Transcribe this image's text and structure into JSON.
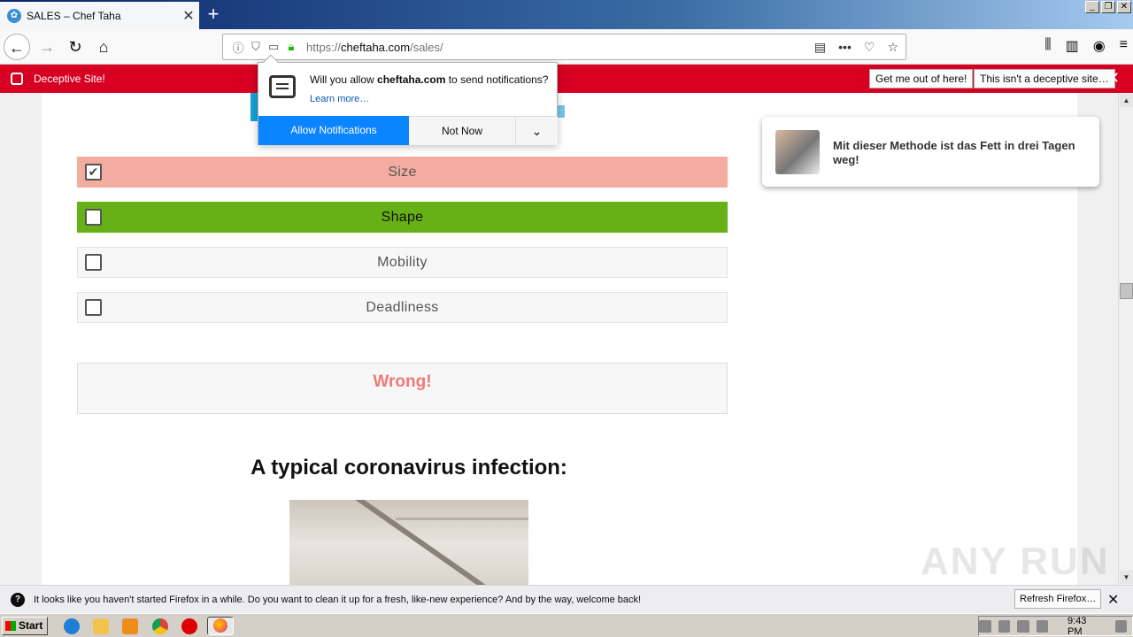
{
  "window": {
    "tab_title": "SALES – Chef Taha",
    "tab_close": "✕",
    "new_tab": "+",
    "controls": [
      "_",
      "❐",
      "✕"
    ]
  },
  "nav": {
    "url_scheme": "https://",
    "url_host": "cheftaha.com",
    "url_path": "/sales/",
    "icons": [
      "back-arrow-icon",
      "forward-arrow-icon",
      "reload-icon",
      "home-icon",
      "info-icon",
      "tracking-shield-icon",
      "notification-icon",
      "lock-icon",
      "reader-view-icon",
      "more-actions-icon",
      "pocket-icon",
      "bookmark-star-icon",
      "library-icon",
      "sidebar-icon",
      "account-icon",
      "hamburger-menu-icon"
    ]
  },
  "deceptive_bar": {
    "message": "Deceptive Site!",
    "get_out_button": "Get me out of here!",
    "not_deceptive_button": "This isn't a deceptive site…",
    "close": "✕"
  },
  "notification_popup": {
    "message_prefix": "Will you allow ",
    "message_host": "cheftaha.com",
    "message_suffix": " to send notifications?",
    "learn_more": "Learn more…",
    "allow_button": "Allow Notifications",
    "not_now_button": "Not Now",
    "more_chevron": "⌄"
  },
  "quiz": {
    "options": [
      {
        "label": "Size",
        "checked": true,
        "check_glyph": "✔"
      },
      {
        "label": "Shape",
        "checked": false,
        "check_glyph": ""
      },
      {
        "label": "Mobility",
        "checked": false,
        "check_glyph": ""
      },
      {
        "label": "Deadliness",
        "checked": false,
        "check_glyph": ""
      }
    ],
    "result": "Wrong!"
  },
  "article": {
    "heading": "A typical coronavirus infection:"
  },
  "ad": {
    "text": "Mit dieser Methode ist das Fett in drei Tagen weg!"
  },
  "watermark": "ANY RUN",
  "firefox_bar": {
    "info_glyph": "?",
    "message": "It looks like you haven't started Firefox in a while. Do you want to clean it up for a fresh, like-new experience? And by the way, welcome back!",
    "refresh_button": "Refresh Firefox…",
    "close": "✕"
  },
  "taskbar": {
    "start": "Start",
    "clock": "9:43 PM"
  },
  "colors": {
    "deceptive_red": "#d70022",
    "allow_blue": "#0a84ff",
    "size_option_bg": "#f4aca0",
    "shape_option_bg": "#66b115",
    "wrong_text": "#f07878"
  }
}
